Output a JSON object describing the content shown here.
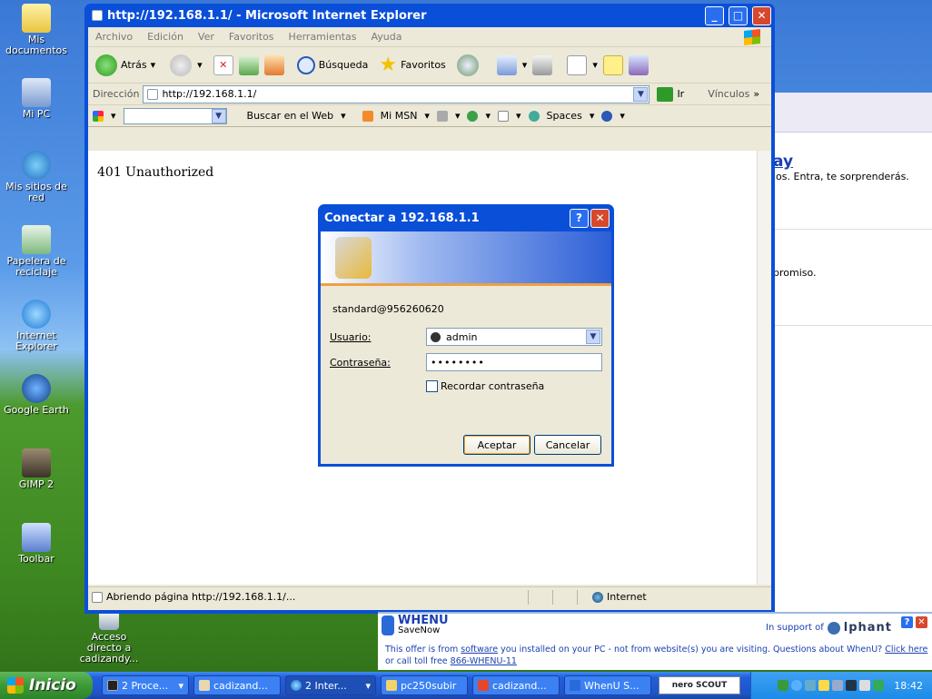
{
  "desktop": {
    "icons": [
      {
        "label": "Mis documentos"
      },
      {
        "label": "Mi PC"
      },
      {
        "label": "Mis sitios de red"
      },
      {
        "label": "Papelera de reciclaje"
      },
      {
        "label": "Internet Explorer"
      },
      {
        "label": "Google Earth"
      },
      {
        "label": "GIMP 2"
      },
      {
        "label": "Toolbar"
      },
      {
        "label": "Acceso directo a cadizandy..."
      }
    ]
  },
  "bgwindow": {
    "heading": "ay",
    "line1": "ios. Entra, te sorprenderás.",
    "line2": "promiso."
  },
  "ie": {
    "title": "http://192.168.1.1/ - Microsoft Internet Explorer",
    "menu": [
      "Archivo",
      "Edición",
      "Ver",
      "Favoritos",
      "Herramientas",
      "Ayuda"
    ],
    "toolbar": {
      "back": "Atrás",
      "search": "Búsqueda",
      "favorites": "Favoritos"
    },
    "address": {
      "label": "Dirección",
      "url": "http://192.168.1.1/",
      "go": "Ir",
      "links": "Vínculos"
    },
    "links": {
      "search_web": "Buscar en el Web",
      "msn": "Mi MSN",
      "spaces": "Spaces"
    },
    "page_text": "401 Unauthorized",
    "status": {
      "text": "Abriendo página http://192.168.1.1/...",
      "zone": "Internet"
    }
  },
  "dialog": {
    "title": "Conectar a 192.168.1.1",
    "realm": "standard@956260620",
    "user_label": "Usuario:",
    "user_value": "admin",
    "pass_label": "Contraseña:",
    "pass_value": "••••••••",
    "remember": "Recordar contraseña",
    "ok": "Aceptar",
    "cancel": "Cancelar"
  },
  "ad": {
    "brand": "WHENU",
    "brand_sub": "SaveNow",
    "support": "In support of",
    "partner": "lphant",
    "line1a": "This offer is from ",
    "line1_link": "software",
    "line1b": " you installed on your PC - not from website(s) you are visiting. Questions about WhenU? ",
    "line1_click": "Click here",
    "line2a": "or call toll free ",
    "line2_phone": "866-WHENU-11"
  },
  "taskbar": {
    "start": "Inicio",
    "tasks": [
      "2 Proce...",
      "cadizand...",
      "2 Inter...",
      "pc250subir",
      "cadizand...",
      "WhenU S..."
    ],
    "nero": "nero SCOUT",
    "clock": "18:42"
  }
}
